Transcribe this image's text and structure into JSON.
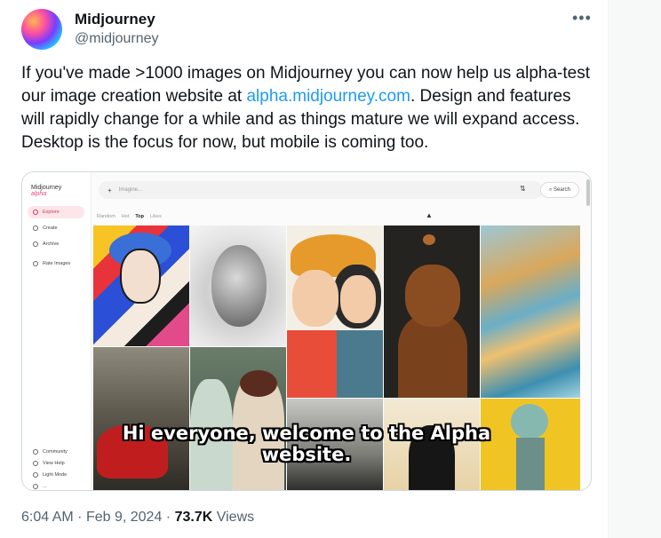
{
  "author": {
    "name": "Midjourney",
    "handle": "@midjourney"
  },
  "tweet": {
    "text_before_link": "If you've made >1000 images on Midjourney you can now help us alpha-test our image creation website at ",
    "link_text": "alpha.midjourney.com",
    "text_after_link": ". Design and features will rapidly change for a while and as things mature we will expand access. Desktop is the focus for now, but mobile is coming too."
  },
  "media": {
    "app": {
      "logo": "Midjourney",
      "logo_sub": "alpha",
      "sidebar_top": [
        "Explore",
        "Create",
        "Archive",
        "Rate Images"
      ],
      "sidebar_bottom": [
        "Community",
        "View Help",
        "Light Mode",
        "..."
      ],
      "search_placeholder": "Imagine...",
      "search_button": "Search",
      "tabs": [
        "Random",
        "Hot",
        "Top",
        "Likes"
      ],
      "active_tab": "Top"
    },
    "caption": "Hi everyone, welcome to the Alpha website."
  },
  "meta": {
    "time": "6:04 AM",
    "date": "Feb 9, 2024",
    "separator": "·",
    "views_count": "73.7K",
    "views_label": "Views"
  },
  "colors": {
    "link": "#1d9bf0",
    "secondary_text": "#536471",
    "active_nav": "#d6335b"
  }
}
